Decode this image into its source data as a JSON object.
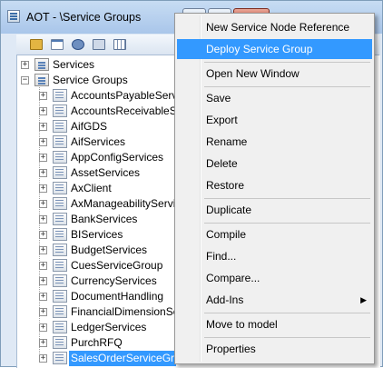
{
  "window": {
    "title": "AOT - \\Service Groups"
  },
  "toolbar": {
    "buttons": [
      "open-icon",
      "properties-icon",
      "compile-icon",
      "import-icon",
      "grid-icon"
    ]
  },
  "tree": {
    "root_items": [
      {
        "label": "Services",
        "expanded": false
      },
      {
        "label": "Service Groups",
        "expanded": true
      }
    ],
    "children": [
      {
        "label": "AccountsPayableServ"
      },
      {
        "label": "AccountsReceivableSe"
      },
      {
        "label": "AifGDS"
      },
      {
        "label": "AifServices"
      },
      {
        "label": "AppConfigServices"
      },
      {
        "label": "AssetServices"
      },
      {
        "label": "AxClient"
      },
      {
        "label": "AxManageabilityServi"
      },
      {
        "label": "BankServices"
      },
      {
        "label": "BIServices"
      },
      {
        "label": "BudgetServices"
      },
      {
        "label": "CuesServiceGroup"
      },
      {
        "label": "CurrencyServices"
      },
      {
        "label": "DocumentHandling"
      },
      {
        "label": "FinancialDimensionSe"
      },
      {
        "label": "LedgerServices"
      },
      {
        "label": "PurchRFQ"
      },
      {
        "label": "SalesOrderServiceGr",
        "selected": true
      }
    ]
  },
  "context_menu": {
    "items": [
      {
        "label": "New Service Node Reference",
        "highlight": false
      },
      {
        "label": "Deploy Service Group",
        "highlight": true
      },
      {
        "separator": true
      },
      {
        "label": "Open New Window"
      },
      {
        "separator": true
      },
      {
        "label": "Save"
      },
      {
        "label": "Export"
      },
      {
        "label": "Rename"
      },
      {
        "label": "Delete"
      },
      {
        "label": "Restore"
      },
      {
        "separator": true
      },
      {
        "label": "Duplicate"
      },
      {
        "separator": true
      },
      {
        "label": "Compile"
      },
      {
        "label": "Find..."
      },
      {
        "label": "Compare..."
      },
      {
        "label": "Add-Ins",
        "submenu": true
      },
      {
        "separator": true
      },
      {
        "label": "Move to model"
      },
      {
        "separator": true
      },
      {
        "label": "Properties"
      }
    ]
  },
  "colors": {
    "selection": "#3399ff",
    "menu_background": "#f0f0f0",
    "titlebar": "#c7dcf3"
  }
}
